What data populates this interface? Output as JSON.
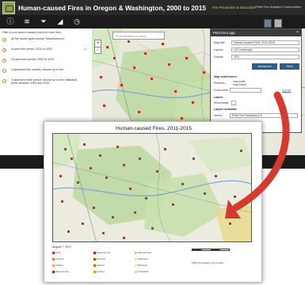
{
  "app": {
    "title": "Human-caused Fires in Oregon & Washington, 2000 to 2015",
    "subtitle": "Fire Prevention & Education",
    "partner": "PNW Fire Adapted Communities"
  },
  "toolbar": {
    "icons": [
      "info-icon",
      "layers-icon",
      "filter-icon",
      "chart-icon",
      "clock-icon"
    ],
    "glyphs": [
      "ⓘ",
      "≋",
      "⏷",
      "◢",
      "◷"
    ]
  },
  "filter_panel": {
    "intro": "Filter to your area or causes (zoom for more info):",
    "options": [
      {
        "label": "All fire cause types except \"Miscellaneous\"",
        "selected": false
      },
      {
        "label": "5-year time period, 2011 to 2015",
        "selected": false,
        "checked": true
      },
      {
        "label": "15-year time period, 2000 to 2015",
        "selected": false
      },
      {
        "label": "Customized fire causes: choose up to five",
        "selected": false
      },
      {
        "label": "Customized time period: choose up to five individual years between 2000 and 2015",
        "selected": false
      }
    ]
  },
  "map": {
    "search_placeholder": "Find address or place",
    "zoom_in": "+",
    "zoom_out": "−"
  },
  "print_panel": {
    "title": "Print from app",
    "close": "×",
    "map_title_label": "Map title:",
    "map_title_value": "Human-caused Fires, 2011-2015",
    "layout_label": "Layout:",
    "layout_value": "US Landscape",
    "format_label": "Format:",
    "format_value": "JPG",
    "advanced_label": "Advanced",
    "print_label": "Print",
    "scale_section": "Map scale/extent",
    "preserve_label": "Preserve:",
    "preserve_options": [
      "map scale",
      "map extent"
    ],
    "force_scale_label": "Force scale:",
    "current_link": "Current",
    "labels_section": "Labels",
    "show_labels": "Show labels",
    "metadata_section": "Layout metadata",
    "author_label": "Author:",
    "author_value": "PNW Fire Prevention & E"
  },
  "output": {
    "title": "Human-caused Fires, 2011-2015",
    "date": "August 7, 2017",
    "legend_items": [
      {
        "label": "Arson",
        "color": "#d62828"
      },
      {
        "label": "Campfire",
        "color": "#e76f51"
      },
      {
        "label": "Children",
        "color": "#f4a261"
      },
      {
        "label": "Debris burning",
        "color": "#9b2226"
      },
      {
        "label": "Equipment use",
        "color": "#ae2012"
      },
      {
        "label": "Fireworks",
        "color": "#bb3e03"
      },
      {
        "label": "Railroad",
        "color": "#ca6702"
      },
      {
        "label": "Smoking",
        "color": "#ee9b00"
      },
      {
        "label": "National forest",
        "color": "#b7d59b"
      },
      {
        "label": "Wilderness",
        "color": "#d8e8b8"
      },
      {
        "label": "BLM lands",
        "color": "#f5e6a8"
      },
      {
        "label": "Tribal lands",
        "color": "#d9c5e0"
      }
    ],
    "credit": "PNW Fire Adapted Communities"
  },
  "colors": {
    "accent": "#d07a19",
    "title_green": "#b8d27a",
    "button_blue": "#2f5b86",
    "fire_red": "#d62828",
    "arrow_red": "#d63a2f"
  }
}
